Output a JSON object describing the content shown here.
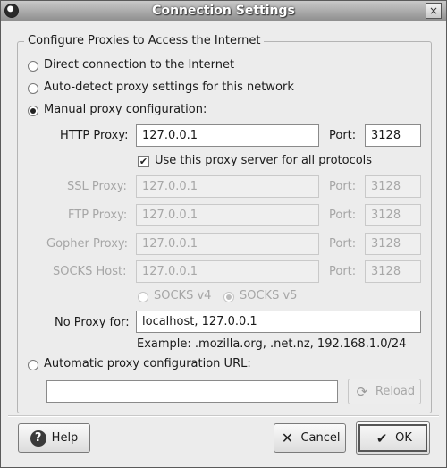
{
  "window": {
    "title": "Connection Settings",
    "close_glyph": "×"
  },
  "group": {
    "label": "Configure Proxies to Access the Internet"
  },
  "options": {
    "direct": "Direct connection to the Internet",
    "auto_detect": "Auto-detect proxy settings for this network",
    "manual": "Manual proxy configuration:",
    "auto_url": "Automatic proxy configuration URL:"
  },
  "manual": {
    "http_label": "HTTP Proxy:",
    "http_value": "127.0.0.1",
    "http_port_label": "Port:",
    "http_port": "3128",
    "use_for_all": "Use this proxy server for all protocols",
    "use_for_all_checked": true,
    "ssl_label": "SSL Proxy:",
    "ssl_value": "127.0.0.1",
    "ssl_port_label": "Port:",
    "ssl_port": "3128",
    "ftp_label": "FTP Proxy:",
    "ftp_value": "127.0.0.1",
    "ftp_port_label": "Port:",
    "ftp_port": "3128",
    "gopher_label": "Gopher Proxy:",
    "gopher_value": "127.0.0.1",
    "gopher_port_label": "Port:",
    "gopher_port": "3128",
    "socks_label": "SOCKS Host:",
    "socks_value": "127.0.0.1",
    "socks_port_label": "Port:",
    "socks_port": "3128",
    "socks_v4": "SOCKS v4",
    "socks_v5": "SOCKS v5",
    "no_proxy_label": "No Proxy for:",
    "no_proxy_value": "localhost, 127.0.0.1",
    "example": "Example: .mozilla.org, .net.nz, 192.168.1.0/24"
  },
  "auto_url": {
    "value": "",
    "reload_label": "Reload"
  },
  "buttons": {
    "help": "Help",
    "cancel": "Cancel",
    "ok": "OK"
  },
  "icons": {
    "help": "?",
    "cancel": "✕",
    "ok": "✔",
    "reload": "⟳"
  },
  "selected_mode": "manual"
}
